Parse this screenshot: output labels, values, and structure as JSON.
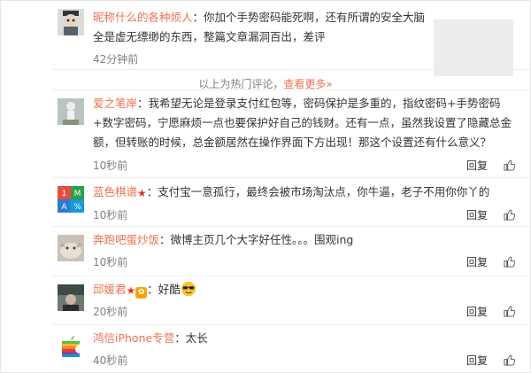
{
  "hot_bar": {
    "prefix": "以上为热门评论，",
    "link": "查看更多»"
  },
  "comments": [
    {
      "user": "昵称什么的各种烦人",
      "sep": "：",
      "text": "你加个手势密码能死啊，还有所谓的安全大脑全是虚无缥缈的东西，整篇文章漏洞百出，差评",
      "time": "42分钟前"
    },
    {
      "user": "爱之笔岸",
      "sep": "：",
      "text": "我希望无论是登录支付红包等，密码保护是多重的，指纹密码+手势密码+数字密码，宁愿麻烦一点也要保护好自己的钱财。还有一点，虽然我设置了隐藏总金额，但转账的时候，总金额居然在操作界面下方出现！那这个设置还有什么意义？",
      "time": "10秒前",
      "reply": "回复"
    },
    {
      "user": "蓝色棋谱",
      "sep": "：",
      "text": "支付宝一意孤行，最终会被市场淘汰点，你牛逼，老子不用你你丫的",
      "time": "10秒前",
      "reply": "回复",
      "avatar_cells": [
        "1",
        "M",
        "A",
        "%"
      ]
    },
    {
      "user": "奔跑吧蛋炒饭",
      "sep": "：",
      "text": "微博主页几个大字好任性。。。围观ing",
      "time": "10秒前",
      "reply": "回复"
    },
    {
      "user": "邱媛君",
      "sep": "：",
      "text": "好酷",
      "time": "20秒前",
      "reply": "回复"
    },
    {
      "user": "鸿信iPhone专营",
      "sep": "：",
      "text": "太长",
      "time": "40秒前",
      "reply": "回复"
    }
  ],
  "colors": {
    "username": "#eb7350",
    "meta": "#808080",
    "text": "#333333"
  },
  "icons": {
    "like": "thumbs-up-icon",
    "verified": "star-badge-icon"
  }
}
